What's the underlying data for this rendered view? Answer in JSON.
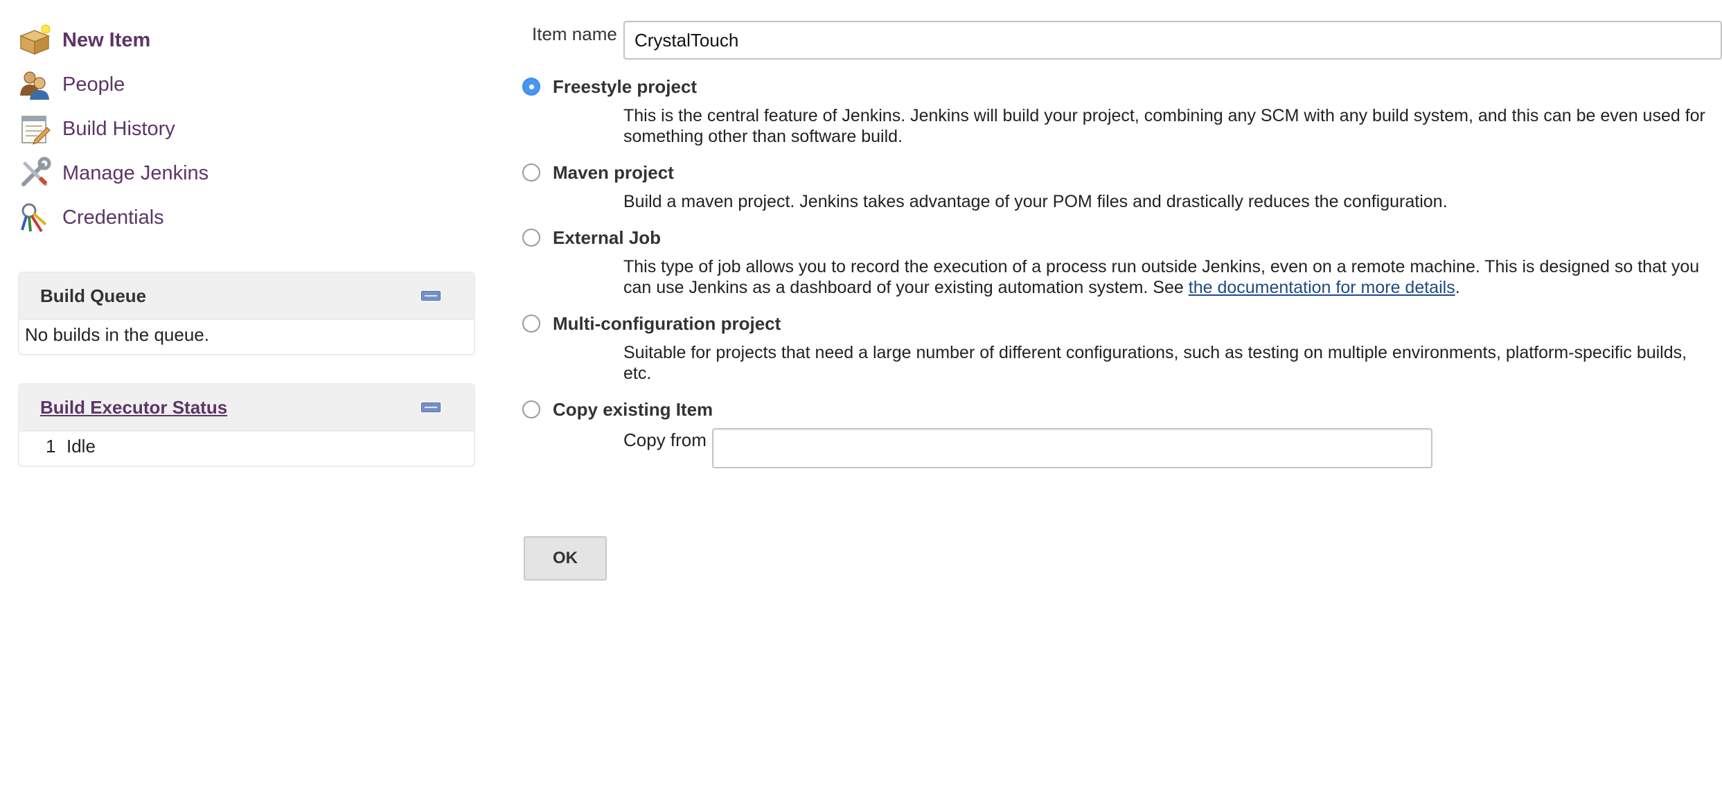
{
  "sidebar": {
    "tasks": [
      {
        "label": "New Item",
        "icon": "new-item-icon",
        "current": true
      },
      {
        "label": "People",
        "icon": "people-icon"
      },
      {
        "label": "Build History",
        "icon": "build-history-icon"
      },
      {
        "label": "Manage Jenkins",
        "icon": "manage-jenkins-icon"
      },
      {
        "label": "Credentials",
        "icon": "credentials-icon"
      }
    ],
    "build_queue": {
      "title": "Build Queue",
      "empty_text": "No builds in the queue."
    },
    "executor_status": {
      "title": "Build Executor Status",
      "executors": [
        {
          "number": "1",
          "state": "Idle"
        }
      ]
    }
  },
  "form": {
    "item_name_label": "Item name",
    "item_name_value": "CrystalTouch",
    "options": [
      {
        "title": "Freestyle project",
        "selected": true,
        "description": "This is the central feature of Jenkins. Jenkins will build your project, combining any SCM with any build system, and this can be even used for something other than software build."
      },
      {
        "title": "Maven project",
        "selected": false,
        "description": "Build a maven project. Jenkins takes advantage of your POM files and drastically reduces the configuration."
      },
      {
        "title": "External Job",
        "selected": false,
        "description_before": "This type of job allows you to record the execution of a process run outside Jenkins, even on a remote machine. This is designed so that you can use Jenkins as a dashboard of your existing automation system. See ",
        "description_link": "the documentation for more details",
        "description_after": "."
      },
      {
        "title": "Multi-configuration project",
        "selected": false,
        "description": "Suitable for projects that need a large number of different configurations, such as testing on multiple environments, platform-specific builds, etc."
      },
      {
        "title": "Copy existing Item",
        "selected": false,
        "copy_from_label": "Copy from",
        "copy_from_value": ""
      }
    ],
    "ok_label": "OK"
  },
  "colors": {
    "link": "#5c3566",
    "doc_link": "#204a87",
    "radio_selected": "#4a97f0",
    "collapse_button": "#7590c6",
    "pane_header_bg": "#f0f0f0"
  }
}
